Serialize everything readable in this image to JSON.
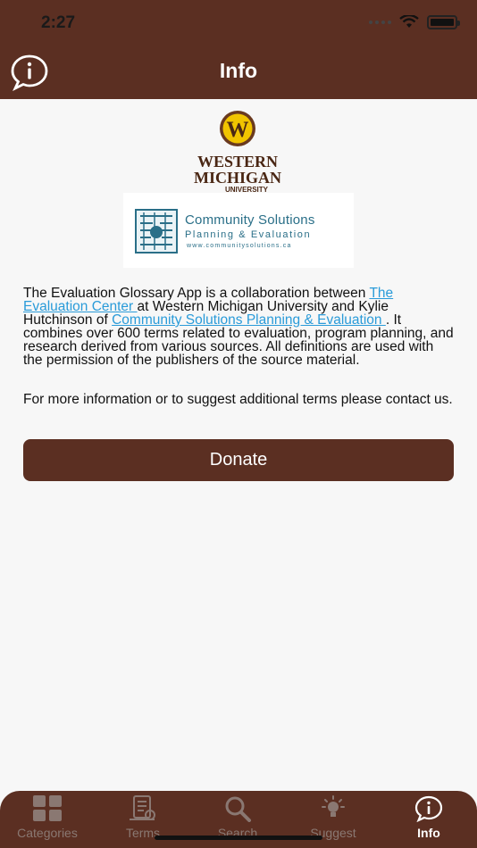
{
  "status_bar": {
    "time": "2:27"
  },
  "header": {
    "title": "Info"
  },
  "logos": {
    "wmu_initial": "W",
    "wmu_line1": "WESTERN",
    "wmu_line2": "MICHIGAN",
    "wmu_line3": "UNIVERSITY",
    "cs_title": "Community Solutions",
    "cs_subtitle": "Planning & Evaluation",
    "cs_url": "www.communitysolutions.ca"
  },
  "body": {
    "p1_a": "The Evaluation Glossary App is a collaboration between ",
    "p1_link1": "The Evaluation Center ",
    "p1_b": "at Western Michigan University and Kylie Hutchinson of ",
    "p1_link2": "Community Solutions Planning & Evaluation ",
    "p1_c": ". It combines over 600 terms related to evaluation, program planning, and research derived from various sources.  All definitions are used with the permission of the publishers of the source material.",
    "p2": "For more information or to suggest additional terms please contact us."
  },
  "donate_label": "Donate",
  "tabs": [
    {
      "label": "Categories",
      "icon": "grid-icon"
    },
    {
      "label": "Terms",
      "icon": "document-icon"
    },
    {
      "label": "Search",
      "icon": "search-icon"
    },
    {
      "label": "Suggest",
      "icon": "lightbulb-icon"
    },
    {
      "label": "Info",
      "icon": "info-icon",
      "active": true
    }
  ],
  "colors": {
    "brand": "#5b2f22",
    "link": "#2a9bd9",
    "wmu_gold": "#f1c400"
  }
}
